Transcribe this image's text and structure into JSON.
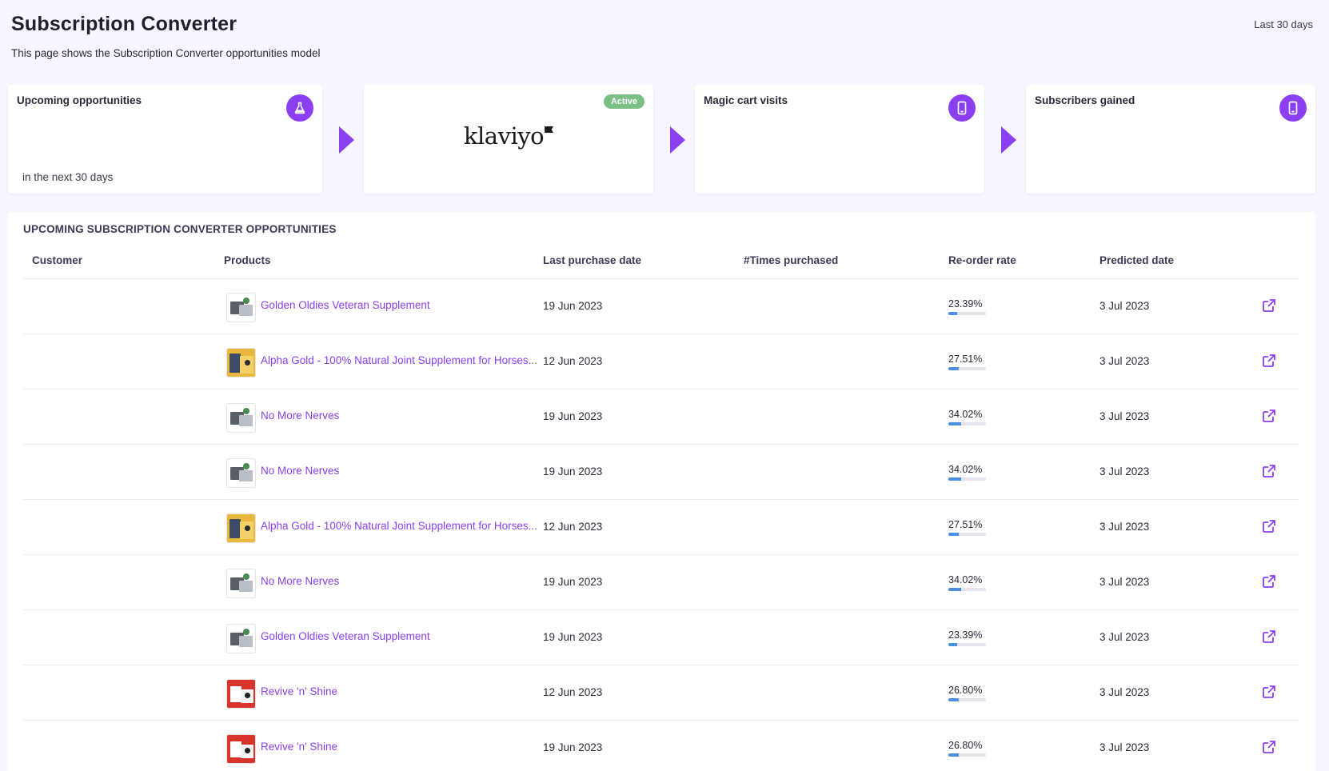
{
  "header": {
    "title": "Subscription Converter",
    "subtitle": "This page shows the Subscription Converter opportunities model",
    "range": "Last 30 days"
  },
  "cards": {
    "upcoming": {
      "title": "Upcoming opportunities",
      "footnote": "in the next 30 days",
      "icon": "flask-icon"
    },
    "klaviyo": {
      "logo_text": "klaviyo",
      "badge": "Active"
    },
    "magic_cart": {
      "title": "Magic cart visits",
      "icon": "mobile-icon"
    },
    "subscribers": {
      "title": "Subscribers gained",
      "icon": "mobile-icon"
    }
  },
  "colors": {
    "accent": "#8a3ff0",
    "badge": "#7cbf85",
    "bar": "#4a90e2"
  },
  "table": {
    "title": "UPCOMING SUBSCRIPTION CONVERTER OPPORTUNITIES",
    "columns": {
      "customer": "Customer",
      "products": "Products",
      "last_purchase": "Last purchase date",
      "times": "#Times purchased",
      "reorder": "Re-order rate",
      "predicted": "Predicted date"
    },
    "rows": [
      {
        "product": "Golden Oldies Veteran Supplement",
        "thumb": "grey",
        "last_purchase": "19 Jun 2023",
        "reorder": "23.39%",
        "reorder_value": 0.2339,
        "predicted": "3 Jul 2023"
      },
      {
        "product": "Alpha Gold - 100% Natural Joint Supplement for Horses...",
        "thumb": "gold",
        "last_purchase": "12 Jun 2023",
        "reorder": "27.51%",
        "reorder_value": 0.2751,
        "predicted": "3 Jul 2023"
      },
      {
        "product": "No More Nerves",
        "thumb": "grey",
        "last_purchase": "19 Jun 2023",
        "reorder": "34.02%",
        "reorder_value": 0.3402,
        "predicted": "3 Jul 2023"
      },
      {
        "product": "No More Nerves",
        "thumb": "grey",
        "last_purchase": "19 Jun 2023",
        "reorder": "34.02%",
        "reorder_value": 0.3402,
        "predicted": "3 Jul 2023"
      },
      {
        "product": "Alpha Gold - 100% Natural Joint Supplement for Horses...",
        "thumb": "gold",
        "last_purchase": "12 Jun 2023",
        "reorder": "27.51%",
        "reorder_value": 0.2751,
        "predicted": "3 Jul 2023"
      },
      {
        "product": "No More Nerves",
        "thumb": "grey",
        "last_purchase": "19 Jun 2023",
        "reorder": "34.02%",
        "reorder_value": 0.3402,
        "predicted": "3 Jul 2023"
      },
      {
        "product": "Golden Oldies Veteran Supplement",
        "thumb": "grey",
        "last_purchase": "19 Jun 2023",
        "reorder": "23.39%",
        "reorder_value": 0.2339,
        "predicted": "3 Jul 2023"
      },
      {
        "product": "Revive 'n' Shine",
        "thumb": "red",
        "last_purchase": "12 Jun 2023",
        "reorder": "26.80%",
        "reorder_value": 0.268,
        "predicted": "3 Jul 2023"
      },
      {
        "product": "Revive 'n' Shine",
        "thumb": "red",
        "last_purchase": "19 Jun 2023",
        "reorder": "26.80%",
        "reorder_value": 0.268,
        "predicted": "3 Jul 2023"
      }
    ]
  }
}
